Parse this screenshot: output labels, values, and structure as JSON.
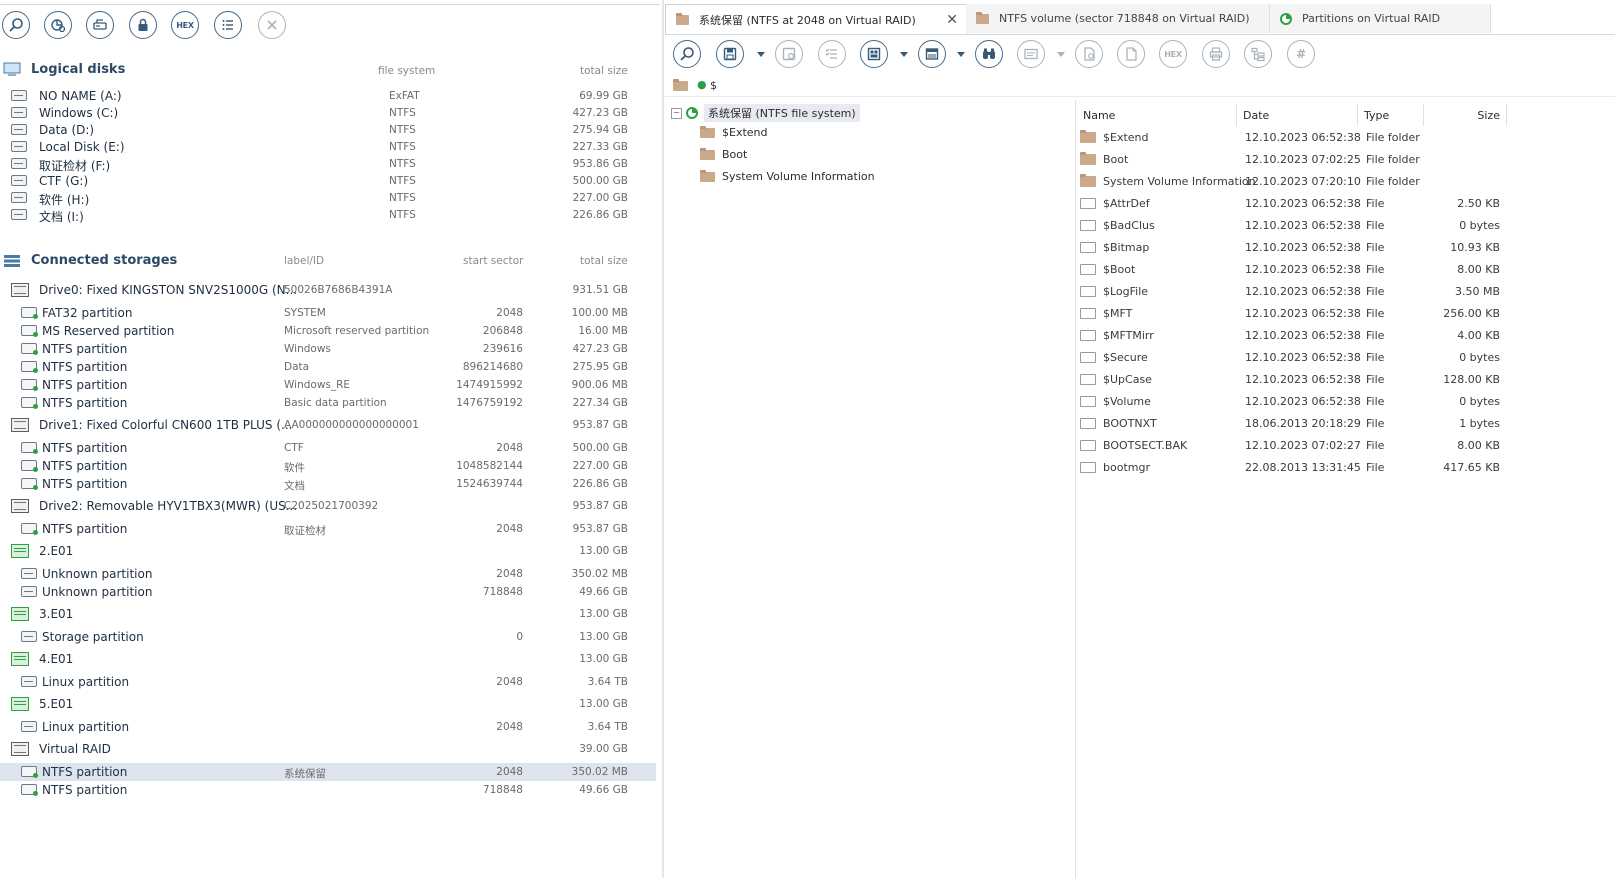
{
  "left_toolbar": {
    "buttons": [
      "search-icon",
      "scan-icon",
      "disk-image-icon",
      "lock-icon",
      "hex",
      "list-icon",
      "close-icon"
    ],
    "hex_label": "HEX"
  },
  "logical": {
    "title": "Logical disks",
    "col_fs": "file system",
    "col_size": "total size",
    "items": [
      {
        "name": "NO NAME (A:)",
        "fs": "ExFAT",
        "size": "69.99 GB"
      },
      {
        "name": "Windows (C:)",
        "fs": "NTFS",
        "size": "427.23 GB"
      },
      {
        "name": "Data (D:)",
        "fs": "NTFS",
        "size": "275.94 GB"
      },
      {
        "name": "Local Disk (E:)",
        "fs": "NTFS",
        "size": "227.33 GB"
      },
      {
        "name": "取证检材 (F:)",
        "fs": "NTFS",
        "size": "953.86 GB"
      },
      {
        "name": "CTF (G:)",
        "fs": "NTFS",
        "size": "500.00 GB"
      },
      {
        "name": "软件 (H:)",
        "fs": "NTFS",
        "size": "227.00 GB"
      },
      {
        "name": "文档 (I:)",
        "fs": "NTFS",
        "size": "226.86 GB"
      }
    ]
  },
  "storages": {
    "title": "Connected storages",
    "col_label": "label/ID",
    "col_start": "start sector",
    "col_size": "total size",
    "rows": [
      {
        "kind": "drive",
        "name": "Drive0: Fixed KINGSTON SNV2S1000G (N...",
        "label": "50026B7686B4391A",
        "start": "",
        "size": "931.51 GB"
      },
      {
        "kind": "part",
        "name": "FAT32 partition",
        "label": "SYSTEM",
        "start": "2048",
        "size": "100.00 MB"
      },
      {
        "kind": "part",
        "name": "MS Reserved partition",
        "label": "Microsoft reserved partition",
        "start": "206848",
        "size": "16.00 MB"
      },
      {
        "kind": "part",
        "name": "NTFS partition",
        "label": "Windows",
        "start": "239616",
        "size": "427.23 GB"
      },
      {
        "kind": "part",
        "name": "NTFS partition",
        "label": "Data",
        "start": "896214680",
        "size": "275.95 GB"
      },
      {
        "kind": "part",
        "name": "NTFS partition",
        "label": "Windows_RE",
        "start": "1474915992",
        "size": "900.06 MB"
      },
      {
        "kind": "part",
        "name": "NTFS partition",
        "label": "Basic data partition",
        "start": "1476759192",
        "size": "227.34 GB"
      },
      {
        "kind": "drive",
        "name": "Drive1: Fixed Colorful CN600 1TB PLUS (...",
        "label": "AA000000000000000001",
        "start": "",
        "size": "953.87 GB"
      },
      {
        "kind": "part",
        "name": "NTFS partition",
        "label": "CTF",
        "start": "2048",
        "size": "500.00 GB"
      },
      {
        "kind": "part",
        "name": "NTFS partition",
        "label": "软件",
        "start": "1048582144",
        "size": "227.00 GB"
      },
      {
        "kind": "part",
        "name": "NTFS partition",
        "label": "文档",
        "start": "1524639744",
        "size": "226.86 GB"
      },
      {
        "kind": "drive",
        "name": "Drive2: Removable HYV1TBX3(MWR) (US...",
        "label": "C2025021700392",
        "start": "",
        "size": "953.87 GB"
      },
      {
        "kind": "part",
        "name": "NTFS partition",
        "label": "取证检材",
        "start": "2048",
        "size": "953.87 GB"
      },
      {
        "kind": "image",
        "name": "2.E01",
        "label": "",
        "start": "",
        "size": "13.00 GB"
      },
      {
        "kind": "upart",
        "name": "Unknown partition",
        "label": "",
        "start": "2048",
        "size": "350.02 MB"
      },
      {
        "kind": "upart",
        "name": "Unknown partition",
        "label": "",
        "start": "718848",
        "size": "49.66 GB"
      },
      {
        "kind": "image",
        "name": "3.E01",
        "label": "",
        "start": "",
        "size": "13.00 GB"
      },
      {
        "kind": "upart",
        "name": "Storage partition",
        "label": "",
        "start": "0",
        "size": "13.00 GB"
      },
      {
        "kind": "image",
        "name": "4.E01",
        "label": "",
        "start": "",
        "size": "13.00 GB"
      },
      {
        "kind": "upart",
        "name": "Linux partition",
        "label": "",
        "start": "2048",
        "size": "3.64 TB"
      },
      {
        "kind": "image",
        "name": "5.E01",
        "label": "",
        "start": "",
        "size": "13.00 GB"
      },
      {
        "kind": "upart",
        "name": "Linux partition",
        "label": "",
        "start": "2048",
        "size": "3.64 TB"
      },
      {
        "kind": "drive",
        "name": "Virtual RAID",
        "label": "",
        "start": "",
        "size": "39.00 GB"
      },
      {
        "kind": "part",
        "name": "NTFS partition",
        "label": "系统保留",
        "start": "2048",
        "size": "350.02 MB",
        "selected": true
      },
      {
        "kind": "part",
        "name": "NTFS partition",
        "label": "",
        "start": "718848",
        "size": "49.66 GB"
      }
    ]
  },
  "tabs": [
    {
      "label": "系统保留 (NTFS at 2048 on Virtual RAID)",
      "active": true,
      "icon": "folder-icon"
    },
    {
      "label": "NTFS volume (sector 718848 on Virtual RAID)",
      "active": false,
      "icon": "folder-icon"
    },
    {
      "label": "Partitions on Virtual RAID",
      "active": false,
      "icon": "partitions-icon"
    }
  ],
  "right_toolbar": {
    "hex_label": "HEX",
    "hash_label": "#"
  },
  "path": "$",
  "tree": {
    "root": "系统保留 (NTFS file system)",
    "children": [
      "$Extend",
      "Boot",
      "System Volume Information"
    ]
  },
  "file_list": {
    "headers": {
      "name": "Name",
      "date": "Date",
      "type": "Type",
      "size": "Size"
    },
    "rows": [
      {
        "name": "$Extend",
        "date": "12.10.2023 06:52:38",
        "type": "File folder",
        "size": "",
        "folder": true
      },
      {
        "name": "Boot",
        "date": "12.10.2023 07:02:25",
        "type": "File folder",
        "size": "",
        "folder": true
      },
      {
        "name": "System Volume Information",
        "date": "12.10.2023 07:20:10",
        "type": "File folder",
        "size": "",
        "folder": true
      },
      {
        "name": "$AttrDef",
        "date": "12.10.2023 06:52:38",
        "type": "File",
        "size": "2.50 KB"
      },
      {
        "name": "$BadClus",
        "date": "12.10.2023 06:52:38",
        "type": "File",
        "size": "0 bytes"
      },
      {
        "name": "$Bitmap",
        "date": "12.10.2023 06:52:38",
        "type": "File",
        "size": "10.93 KB"
      },
      {
        "name": "$Boot",
        "date": "12.10.2023 06:52:38",
        "type": "File",
        "size": "8.00 KB"
      },
      {
        "name": "$LogFile",
        "date": "12.10.2023 06:52:38",
        "type": "File",
        "size": "3.50 MB"
      },
      {
        "name": "$MFT",
        "date": "12.10.2023 06:52:38",
        "type": "File",
        "size": "256.00 KB"
      },
      {
        "name": "$MFTMirr",
        "date": "12.10.2023 06:52:38",
        "type": "File",
        "size": "4.00 KB"
      },
      {
        "name": "$Secure",
        "date": "12.10.2023 06:52:38",
        "type": "File",
        "size": "0 bytes"
      },
      {
        "name": "$UpCase",
        "date": "12.10.2023 06:52:38",
        "type": "File",
        "size": "128.00 KB"
      },
      {
        "name": "$Volume",
        "date": "12.10.2023 06:52:38",
        "type": "File",
        "size": "0 bytes"
      },
      {
        "name": "BOOTNXT",
        "date": "18.06.2013 20:18:29",
        "type": "File",
        "size": "1 bytes"
      },
      {
        "name": "BOOTSECT.BAK",
        "date": "12.10.2023 07:02:27",
        "type": "File",
        "size": "8.00 KB"
      },
      {
        "name": "bootmgr",
        "date": "22.08.2013 13:31:45",
        "type": "File",
        "size": "417.65 KB"
      }
    ]
  }
}
